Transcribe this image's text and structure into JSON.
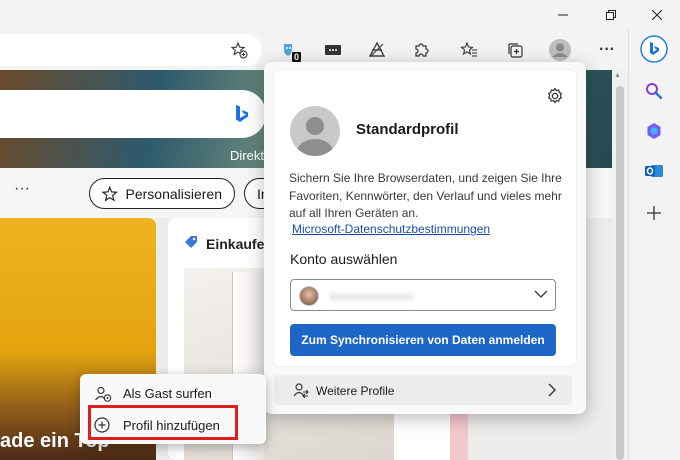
{
  "window": {
    "minimize": "minimize",
    "restore": "restore",
    "close": "close"
  },
  "toolbar": {
    "extension_badge": "0",
    "more_label": "···"
  },
  "page": {
    "hero_direkt": "Direkt",
    "subbar_more": "···",
    "personalize_label": "Personalisieren",
    "pill_partial": "In",
    "card_shopping_title": "Einkaufen",
    "card_yellow_text": "ade ein Top"
  },
  "profile_flyout": {
    "profile_name": "Standardprofil",
    "description": "Sichern Sie Ihre Browserdaten, und zeigen Sie Ihre Favoriten, Kennwörter, den Verlauf und vieles mehr auf all Ihren Geräten an.",
    "privacy_link": "Microsoft-Datenschutzbestimmungen",
    "account_label": "Konto auswählen",
    "account_value": "xxxxxxxxxxxx",
    "sync_button": "Zum Synchronisieren von Daten anmelden",
    "more_profiles": "Weitere Profile"
  },
  "context_menu": {
    "items": [
      {
        "label": "Als Gast surfen"
      },
      {
        "label": "Profil hinzufügen"
      }
    ]
  },
  "colors": {
    "accent": "#1d66c7",
    "highlight": "#e01e1e",
    "link": "#1a4fa8"
  }
}
